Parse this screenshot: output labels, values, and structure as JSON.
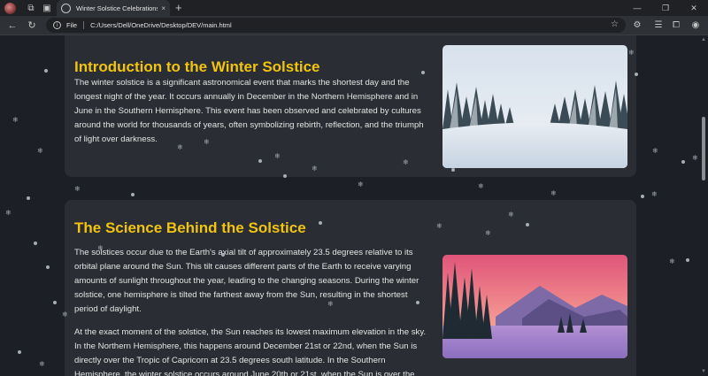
{
  "browser": {
    "tab_title": "Winter Solstice Celebrations Arou",
    "new_tab_symbol": "+",
    "close_tab_symbol": "×",
    "url_scheme": "File",
    "url": "C:/Users/Dell/OneDrive/Desktop/DEV/main.html",
    "window_controls": [
      "—",
      "❐",
      "✕"
    ]
  },
  "sections": [
    {
      "title": "Introduction to the Winter Solstice",
      "paragraphs": [
        "The winter solstice is a significant astronomical event that marks the shortest day and the longest night of the year. It occurs annually in December in the Northern Hemisphere and in June in the Southern Hemisphere. This event has been observed and celebrated by cultures around the world for thousands of years, often symbolizing rebirth, reflection, and the triumph of light over darkness."
      ],
      "image": "snowy-pine-forest"
    },
    {
      "title": "The Science Behind the Solstice",
      "paragraphs": [
        "The solstices occur due to the Earth's axial tilt of approximately 23.5 degrees relative to its orbital plane around the Sun. This tilt causes different parts of the Earth to receive varying amounts of sunlight throughout the year, leading to the changing seasons. During the winter solstice, one hemisphere is tilted the farthest away from the Sun, resulting in the shortest period of daylight.",
        "At the exact moment of the solstice, the Sun reaches its lowest maximum elevation in the sky. In the Northern Hemisphere, this happens around December 21st or 22nd, when the Sun is directly over the Tropic of Capricorn at 23.5 degrees south latitude. In the Southern Hemisphere, the winter solstice occurs around June 20th or 21st, when the Sun is over the"
      ],
      "image": "pink-sunset-snowy-mountains"
    }
  ],
  "colors": {
    "heading": "#f2c40f",
    "card": "#2a2d33",
    "page_bg": "#1c1f25"
  }
}
